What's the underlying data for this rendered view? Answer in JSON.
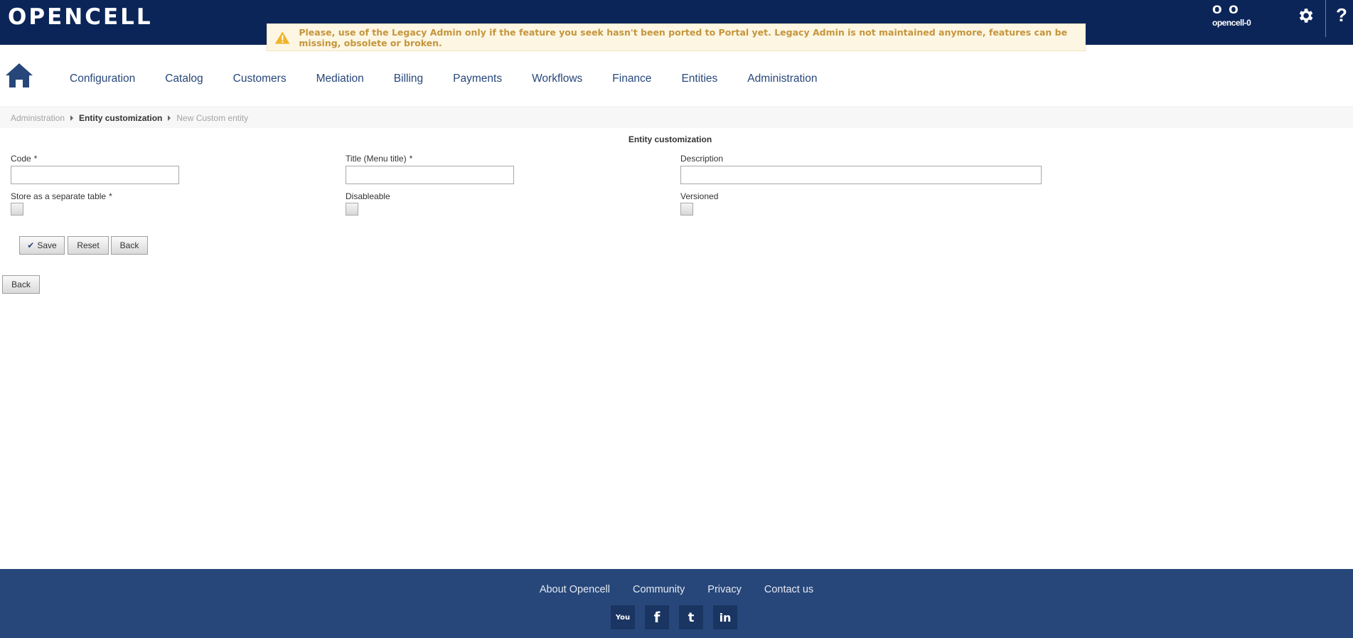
{
  "header": {
    "logo_text": "OPENCELL",
    "warning": "Please, use of the Legacy Admin only if the feature you seek hasn't been ported to Portal yet. Legacy Admin is not maintained anymore, features can be missing, obsolete or broken.",
    "user_initials": "O O",
    "user_name": "opencell-0",
    "help_label": "?",
    "icons": {
      "warning": "warning-icon",
      "settings": "gear-icon",
      "home": "home-icon"
    }
  },
  "nav": {
    "items": [
      "Configuration",
      "Catalog",
      "Customers",
      "Mediation",
      "Billing",
      "Payments",
      "Workflows",
      "Finance",
      "Entities",
      "Administration"
    ]
  },
  "breadcrumb": [
    "Administration",
    "Entity customization",
    "New Custom entity"
  ],
  "form": {
    "title": "Entity customization",
    "code_label": "Code",
    "title_label": "Title (Menu title)",
    "description_label": "Description",
    "store_label": "Store as a separate table",
    "disableable_label": "Disableable",
    "versioned_label": "Versioned",
    "required_mark": "*",
    "code_value": "",
    "title_value": "",
    "description_value": ""
  },
  "buttons": {
    "save": "Save",
    "reset": "Reset",
    "back": "Back",
    "back_bottom": "Back"
  },
  "footer": {
    "links": [
      "About Opencell",
      "Community",
      "Privacy",
      "Contact us"
    ],
    "social": [
      {
        "name": "youtube-icon",
        "glyph": "You"
      },
      {
        "name": "facebook-icon",
        "glyph": "f"
      },
      {
        "name": "twitter-icon",
        "glyph": "t"
      },
      {
        "name": "linkedin-icon",
        "glyph": "in"
      }
    ]
  },
  "colors": {
    "header_bg": "#0b2558",
    "footer_bg": "#27477a",
    "warning_bg": "#fdf6e3",
    "warning_text": "#c4963d",
    "nav_text": "#27477a"
  }
}
